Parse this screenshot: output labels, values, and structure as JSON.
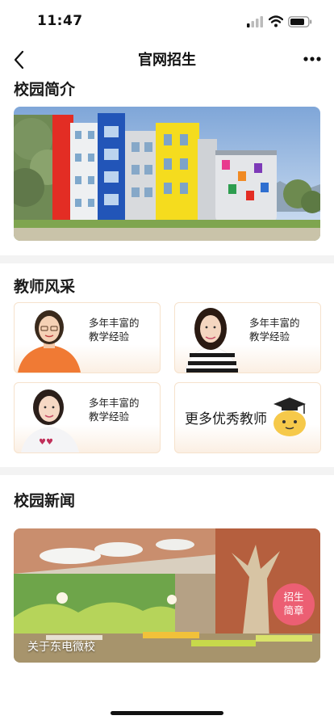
{
  "status_bar": {
    "time": "11:47"
  },
  "nav": {
    "title": "官网招生",
    "back_icon": "chevron-left-icon",
    "more_icon": "more-dots-icon"
  },
  "sections": {
    "campus_intro": {
      "title": "校园简介"
    },
    "teachers": {
      "title": "教师风采",
      "cards": [
        {
          "line1": "多年丰富的",
          "line2": "教学经验"
        },
        {
          "line1": "多年丰富的",
          "line2": "教学经验"
        },
        {
          "line1": "多年丰富的",
          "line2": "教学经验"
        }
      ],
      "more_label": "更多优秀教师"
    },
    "news": {
      "title": "校园新闻",
      "caption": "关于东电微校",
      "badge_line1": "招生",
      "badge_line2": "简章"
    }
  },
  "colors": {
    "badge": "#ec5f73",
    "card_border": "#f6e2cc",
    "separator": "#f3f3f3"
  }
}
